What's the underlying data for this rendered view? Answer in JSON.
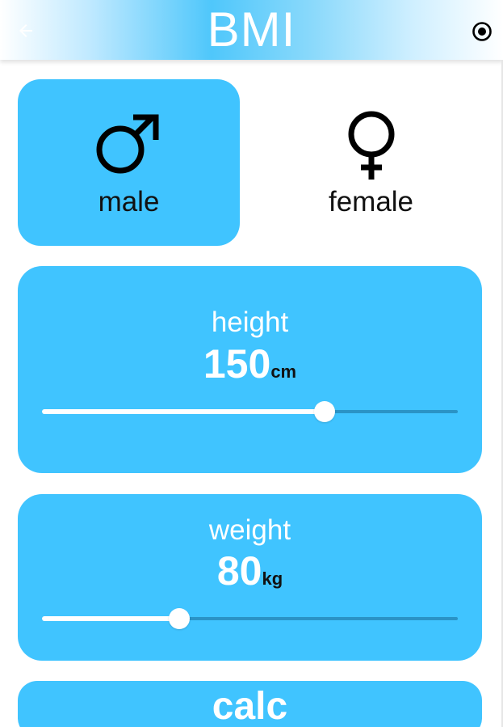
{
  "app_bar": {
    "title": "BMI",
    "back_icon": "arrow-left-icon",
    "action_icon": "radio-button-icon"
  },
  "gender": {
    "selected": "male",
    "options": [
      {
        "id": "male",
        "label": "male",
        "icon": "male-symbol-icon"
      },
      {
        "id": "female",
        "label": "female",
        "icon": "female-symbol-icon"
      }
    ]
  },
  "height": {
    "label": "height",
    "value": "150",
    "unit": "cm",
    "slider_fraction": 0.68
  },
  "weight": {
    "label": "weight",
    "value": "80",
    "unit": "kg",
    "slider_fraction": 0.33
  },
  "calc_button": {
    "label": "calc"
  },
  "colors": {
    "accent": "#40c4ff",
    "track_inactive": "#2a93c6",
    "on_accent_text": "#ffffff",
    "dark_text": "#111111"
  }
}
